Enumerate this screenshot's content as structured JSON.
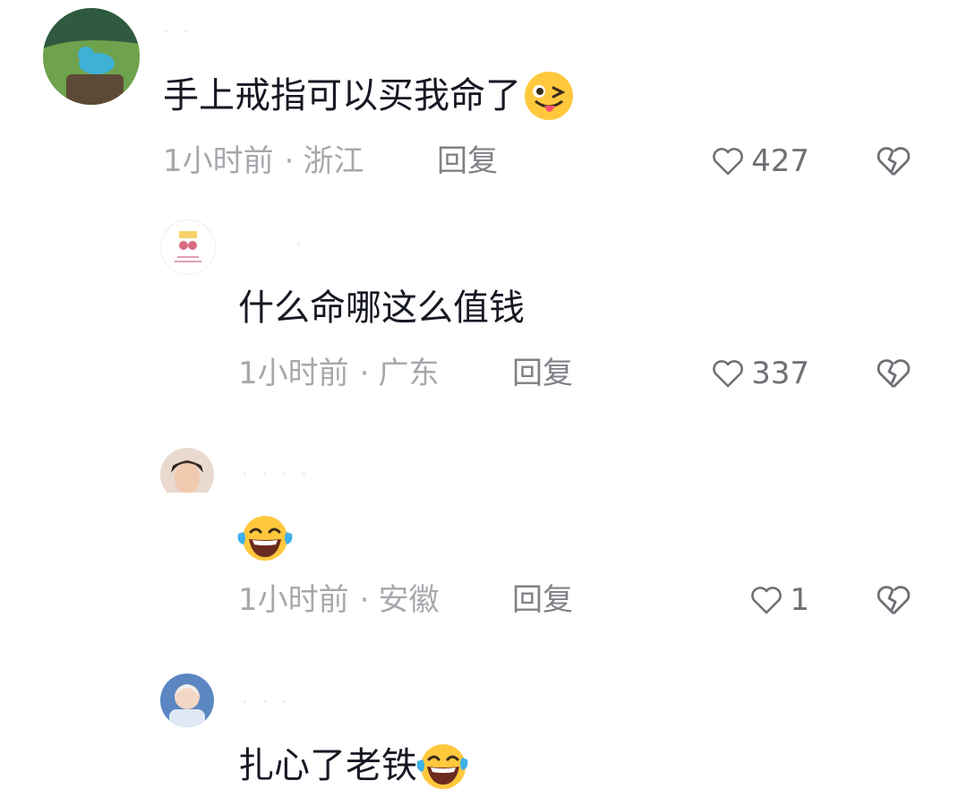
{
  "comments": [
    {
      "username": "·  ·",
      "text": "手上戒指可以买我命了",
      "text_emoji": "wink-tongue-emoji",
      "time": "1小时前",
      "location": "浙江",
      "reply_label": "回复",
      "likes": "427"
    },
    {
      "username": "·",
      "text": "什么命哪这么值钱",
      "time": "1小时前",
      "location": "广东",
      "reply_label": "回复",
      "likes": "337"
    },
    {
      "username": "· ·  ·   ·",
      "text": "",
      "text_emoji": "laughing-tears-emoji",
      "time": "1小时前",
      "location": "安徽",
      "reply_label": "回复",
      "likes": "1"
    },
    {
      "username": "·   ·  ·",
      "text": "扎心了老铁",
      "text_emoji": "laughing-tears-emoji"
    }
  ],
  "separator": "·",
  "colors": {
    "text_primary": "#161823",
    "meta_gray": "#a7a8ad",
    "reply_gray": "#808187",
    "icon_gray": "#6f7076"
  }
}
